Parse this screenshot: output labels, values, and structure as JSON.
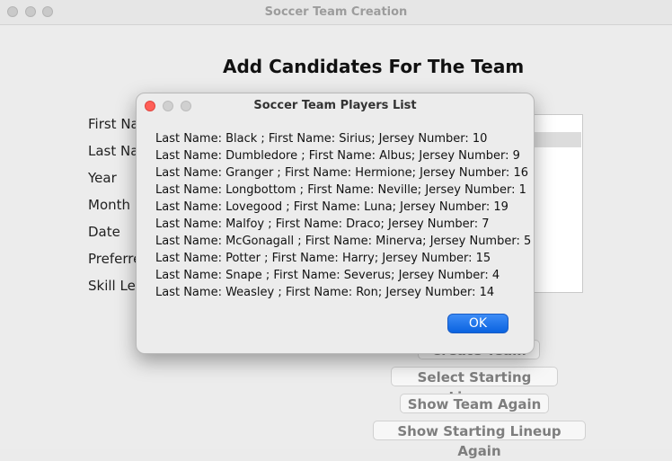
{
  "window": {
    "title": "Soccer Team Creation"
  },
  "main": {
    "heading": "Add Candidates For The Team",
    "labels": [
      "First Na",
      "Last Na",
      "Year",
      "Month",
      "Date",
      "Preferre",
      "Skill Lev"
    ],
    "buttons": {
      "create_team": "Create Team",
      "select_lineup": "Select Starting Lineup",
      "show_team": "Show Team Again",
      "show_lineup": "Show Starting Lineup Again"
    }
  },
  "dialog": {
    "title": "Soccer Team Players List",
    "players": [
      "Last Name: Black ; First Name: Sirius; Jersey Number: 10",
      "Last Name: Dumbledore ; First Name: Albus; Jersey Number: 9",
      "Last Name: Granger ; First Name: Hermione; Jersey Number: 16",
      "Last Name: Longbottom ; First Name: Neville; Jersey Number: 1",
      "Last Name: Lovegood ; First Name: Luna; Jersey Number: 19",
      "Last Name: Malfoy ; First Name: Draco; Jersey Number: 7",
      "Last Name: McGonagall ; First Name: Minerva; Jersey Number: 5",
      "Last Name: Potter ; First Name: Harry; Jersey Number: 15",
      "Last Name: Snape ; First Name: Severus; Jersey Number: 4",
      "Last Name: Weasley ; First Name: Ron; Jersey Number: 14"
    ],
    "ok_label": "OK"
  },
  "colors": {
    "accent": "#0a63e0",
    "close_red": "#ff5f57"
  }
}
